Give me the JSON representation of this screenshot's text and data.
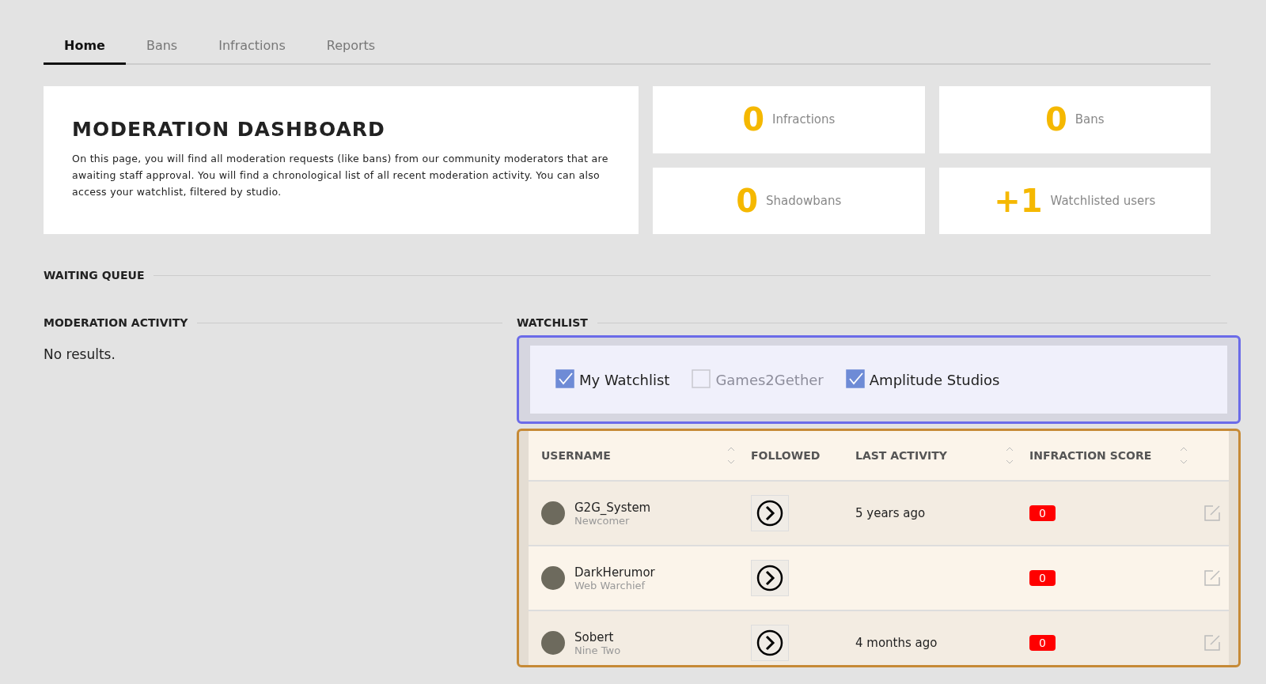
{
  "tabs": [
    {
      "label": "Home",
      "selected": true
    },
    {
      "label": "Bans",
      "selected": false
    },
    {
      "label": "Infractions",
      "selected": false
    },
    {
      "label": "Reports",
      "selected": false
    }
  ],
  "intro": {
    "title": "MODERATION DASHBOARD",
    "text": "On this page, you will find all moderation requests (like bans) from our community moderators that are awaiting staff approval. You will find a chronological list of all recent moderation activity. You can also access your watchlist, filtered by studio."
  },
  "stats": [
    {
      "value": "0",
      "label": "Infractions"
    },
    {
      "value": "0",
      "label": "Bans"
    },
    {
      "value": "0",
      "label": "Shadowbans"
    },
    {
      "value": "+1",
      "label": "Watchlisted users"
    }
  ],
  "waiting_queue": {
    "title": "WAITING QUEUE"
  },
  "moderation_activity": {
    "title": "MODERATION ACTIVITY",
    "empty": "No results."
  },
  "watchlist": {
    "title": "WATCHLIST",
    "filters": [
      {
        "label": "My Watchlist",
        "checked": true
      },
      {
        "label": "Games2Gether",
        "checked": false
      },
      {
        "label": "Amplitude Studios",
        "checked": true
      }
    ],
    "columns": [
      {
        "label": "USERNAME",
        "sortable": true
      },
      {
        "label": "FOLLOWED",
        "sortable": false
      },
      {
        "label": "LAST ACTIVITY",
        "sortable": true
      },
      {
        "label": "INFRACTION SCORE",
        "sortable": true
      }
    ],
    "rows": [
      {
        "name": "G2G_System",
        "rank": "Newcomer",
        "last_activity": "5 years ago",
        "score": "0"
      },
      {
        "name": "DarkHerumor",
        "rank": "Web Warchief",
        "last_activity": "",
        "score": "0"
      },
      {
        "name": "Sobert",
        "rank": "Nine Two",
        "last_activity": "4 months ago",
        "score": "0"
      }
    ]
  }
}
